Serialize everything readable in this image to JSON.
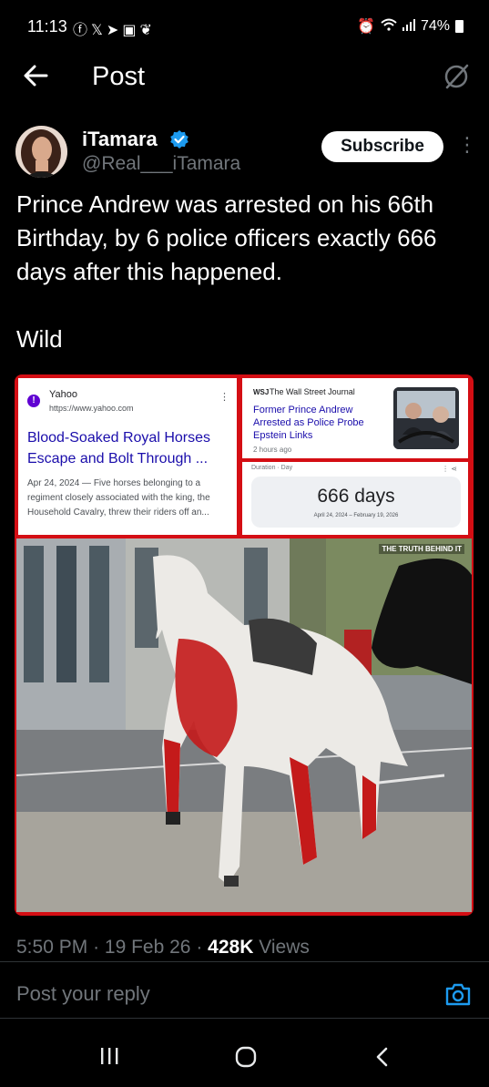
{
  "status_bar": {
    "time": "11:13",
    "battery": "74%",
    "notification_icons": [
      "facebook-icon",
      "x-icon",
      "telegram-icon",
      "gallery-icon",
      "leaf-icon"
    ],
    "status_icons": [
      "alarm-icon",
      "wifi-icon",
      "signal-icon",
      "battery-icon"
    ]
  },
  "header": {
    "title": "Post"
  },
  "author": {
    "display_name": "iTamara",
    "handle": "@Real___iTamara",
    "verified": true,
    "verified_color": "#1d9bf0",
    "subscribe_label": "Subscribe"
  },
  "post": {
    "text": "Prince Andrew was arrested on his 66th Birthday,  by 6 police officers exactly 666 days after this happened.",
    "text_2": "Wild"
  },
  "media": {
    "frame_color": "#d40e14",
    "yahoo_card": {
      "source": "Yahoo",
      "url": "https://www.yahoo.com",
      "headline": "Blood-Soaked Royal Horses Escape and Bolt Through ...",
      "snippet": "Apr 24, 2024 — Five horses belonging to a regiment closely associated with the king, the Household Cavalry, threw their riders off an..."
    },
    "wsj_card": {
      "logo": "WSJ",
      "source": "The Wall Street Journal",
      "headline": "Former Prince Andrew Arrested as Police Probe Epstein Links",
      "time": "2 hours ago"
    },
    "duration_card": {
      "label": "Duration · Day",
      "value": "666 days",
      "range": "April 24, 2024 – February 19, 2026"
    },
    "watermark": "THE TRUTH BEHIND IT"
  },
  "meta": {
    "time": "5:50 PM",
    "date": "19 Feb 26",
    "views_count": "428K",
    "views_label": "Views",
    "separator": "·"
  },
  "reply": {
    "placeholder": "Post your reply"
  },
  "colors": {
    "background": "#000000",
    "text": "#e7e9ea",
    "muted": "#71767b",
    "accent": "#1d9bf0"
  }
}
